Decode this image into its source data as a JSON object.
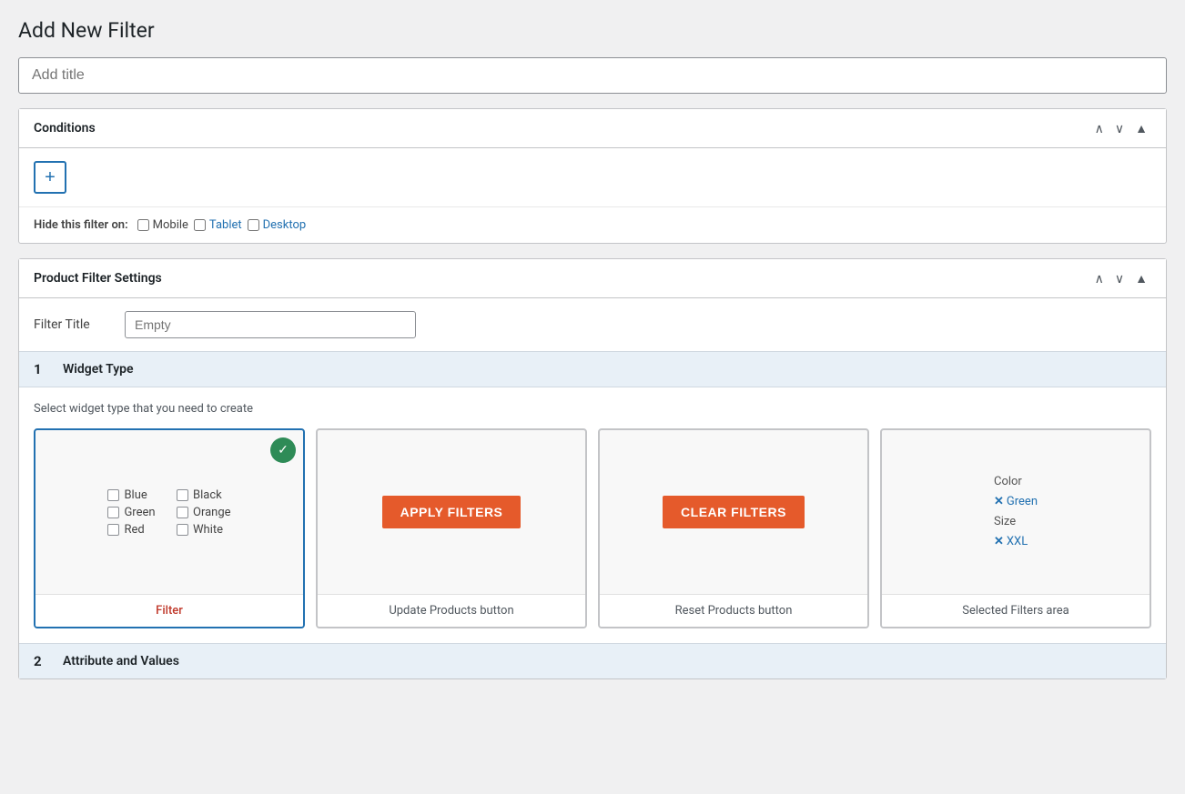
{
  "page": {
    "title": "Add New Filter"
  },
  "title_input": {
    "placeholder": "Add title",
    "value": ""
  },
  "conditions_panel": {
    "title": "Conditions",
    "add_button_label": "+",
    "hide_filter_label": "Hide this filter on:",
    "hide_options": [
      {
        "id": "mobile",
        "label": "Mobile",
        "checked": false
      },
      {
        "id": "tablet",
        "label": "Tablet",
        "checked": false
      },
      {
        "id": "desktop",
        "label": "Desktop",
        "checked": false
      }
    ]
  },
  "product_filter_panel": {
    "title": "Product Filter Settings",
    "filter_title_label": "Filter Title",
    "filter_title_placeholder": "Empty",
    "filter_title_value": ""
  },
  "widget_type_section": {
    "number": "1",
    "label": "Widget Type",
    "description": "Select widget type that you need to create",
    "cards": [
      {
        "id": "filter",
        "label": "Filter",
        "selected": true,
        "type": "filter-preview"
      },
      {
        "id": "update-products",
        "label": "Update Products button",
        "selected": false,
        "type": "apply-button"
      },
      {
        "id": "reset-products",
        "label": "Reset Products button",
        "selected": false,
        "type": "clear-button"
      },
      {
        "id": "selected-filters",
        "label": "Selected Filters area",
        "selected": false,
        "type": "selected-filters"
      }
    ],
    "filter_preview_items": [
      {
        "label": "Blue"
      },
      {
        "label": "Black"
      },
      {
        "label": "Green"
      },
      {
        "label": "Orange"
      },
      {
        "label": "Red"
      },
      {
        "label": "White"
      }
    ],
    "apply_button_text": "APPLY FILTERS",
    "clear_button_text": "CLEAR FILTERS",
    "selected_filters": {
      "color_label": "Color",
      "color_value": "Green",
      "size_label": "Size",
      "size_value": "XXL"
    }
  },
  "attribute_section": {
    "number": "2",
    "label": "Attribute and Values"
  },
  "icons": {
    "chevron_up": "∧",
    "chevron_down": "∨",
    "triangle_up": "▲",
    "checkmark": "✓"
  }
}
